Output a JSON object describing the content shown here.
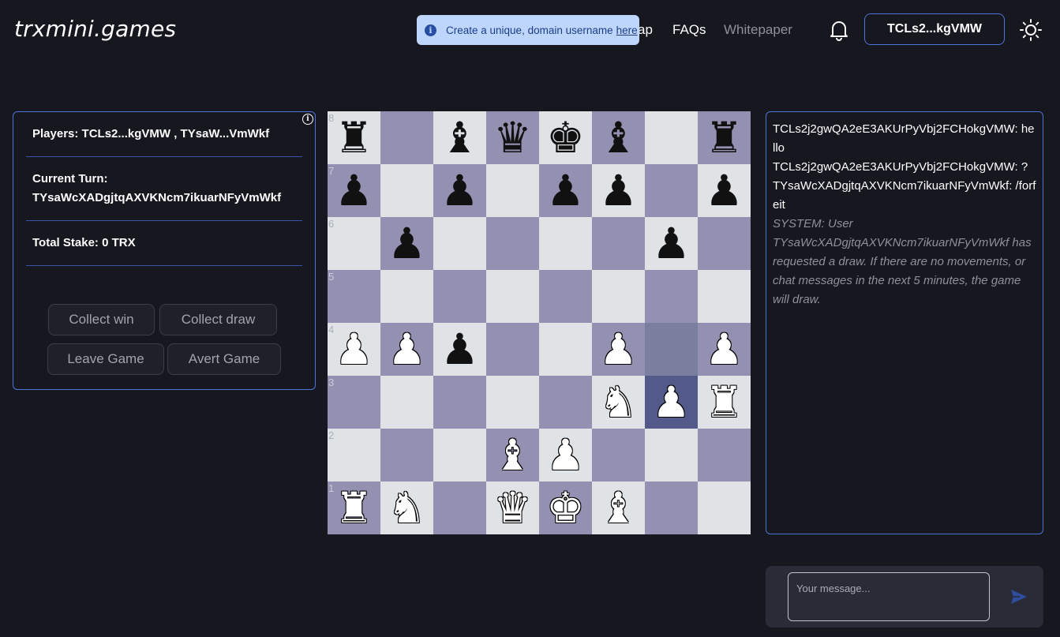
{
  "header": {
    "brand": "trxmini.games",
    "nav": [
      "ap",
      "FAQs",
      "Whitepaper"
    ],
    "wallet_label": "TCLs2...kgVMW",
    "bell_icon": "bell-icon",
    "theme_icon": "sun-icon"
  },
  "toast": {
    "text": "Create a unique, domain username",
    "link": "here",
    "info_glyph": "i"
  },
  "game": {
    "players": "Players: TCLs2...kgVMW , TYsaW...VmWkf",
    "current_turn_label": "Current Turn:",
    "current_turn_value": "TYsaWcXADgjtqAXVKNcm7ikuarNFyVmWkf",
    "total_stake": "Total Stake: 0 TRX",
    "buttons": {
      "collect_win": "Collect win",
      "collect_draw": "Collect draw",
      "leave": "Leave Game",
      "avert": "Avert Game"
    }
  },
  "board": {
    "ranks": [
      "8",
      "7",
      "6",
      "5",
      "4",
      "3",
      "2",
      "1"
    ],
    "rows": [
      [
        "bR",
        "",
        "bB",
        "bQ",
        "bK",
        "bB",
        "",
        "bR"
      ],
      [
        "bP",
        "",
        "bP",
        "",
        "bP",
        "bP",
        "",
        "bP"
      ],
      [
        "",
        "bP",
        "",
        "",
        "",
        "",
        "bP",
        ""
      ],
      [
        "",
        "",
        "",
        "",
        "",
        "",
        "",
        ""
      ],
      [
        "wP",
        "wP",
        "bP",
        "",
        "",
        "wP",
        "",
        "wP"
      ],
      [
        "",
        "",
        "",
        "",
        "",
        "wN",
        "wP",
        "wR"
      ],
      [
        "",
        "",
        "",
        "wB",
        "wP",
        "",
        "",
        ""
      ],
      [
        "wR",
        "wN",
        "",
        "wQ",
        "wK",
        "wB",
        "",
        ""
      ]
    ],
    "highlight": [
      "4-6",
      "5-6"
    ]
  },
  "chat": {
    "messages": [
      {
        "type": "user",
        "text": "TCLs2j2gwQA2eE3AKUrPyVbj2FCHokgVMW: hello"
      },
      {
        "type": "user",
        "text": "TCLs2j2gwQA2eE3AKUrPyVbj2FCHokgVMW: ?"
      },
      {
        "type": "user",
        "text": "TYsaWcXADgjtqAXVKNcm7ikuarNFyVmWkf: /forfeit"
      },
      {
        "type": "system",
        "text": "SYSTEM: User TYsaWcXADgjtqAXVKNcm7ikuarNFyVmWkf has requested a draw. If there are no movements, or chat messages in the next 5 minutes, the game will draw."
      }
    ],
    "input_placeholder": "Your message...",
    "send_icon": "send-icon"
  },
  "colors": {
    "accent": "#4b73d8",
    "board_light": "#dfe3e6",
    "board_dark": "#9490b2"
  }
}
